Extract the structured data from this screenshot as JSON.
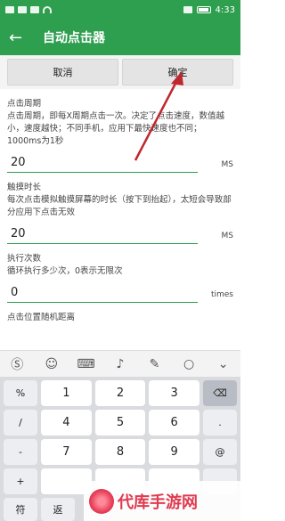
{
  "status_bar": {
    "time": "4:33",
    "left_icons": [
      "notification-icon",
      "notification-icon",
      "notification-icon"
    ],
    "right_icons": [
      "alarm-icon",
      "battery-icon"
    ]
  },
  "app_bar": {
    "title": "自动点击器",
    "back_icon": "back-arrow-icon"
  },
  "actions": {
    "cancel": "取消",
    "confirm": "确定"
  },
  "sections": [
    {
      "title": "点击周期",
      "desc": "点击周期，即每X周期点击一次。决定了点击速度，数值越小，速度越快；不同手机，应用下最快速度也不同；1000ms为1秒",
      "value": "20",
      "unit": "MS"
    },
    {
      "title": "触摸时长",
      "desc": "每次点击模拟触摸屏幕的时长（按下到抬起），太短会导致部分应用下点击无效",
      "value": "20",
      "unit": "MS"
    },
    {
      "title": "执行次数",
      "desc": "循环执行多少次，0表示无限次",
      "value": "0",
      "unit": "times"
    },
    {
      "title": "点击位置随机距离",
      "desc": "",
      "value": "",
      "unit": ""
    }
  ],
  "keyboard": {
    "toolbar_icons": [
      "sogou-icon",
      "emoji-icon",
      "keyboard-icon",
      "microphone-icon",
      "handwriting-icon",
      "search-icon",
      "collapse-icon"
    ],
    "left_column": [
      "%",
      "/",
      "-",
      "+"
    ],
    "digits": [
      "1",
      "2",
      "3",
      "4",
      "5",
      "6",
      "7",
      "8",
      "9"
    ],
    "right_column": [
      "⌫",
      ".",
      "@"
    ],
    "bottom_row": [
      "符",
      "返"
    ]
  },
  "watermark": {
    "text": "代库手游网"
  },
  "colors": {
    "accent": "#2e9e4f",
    "arrow": "#c0262d"
  }
}
